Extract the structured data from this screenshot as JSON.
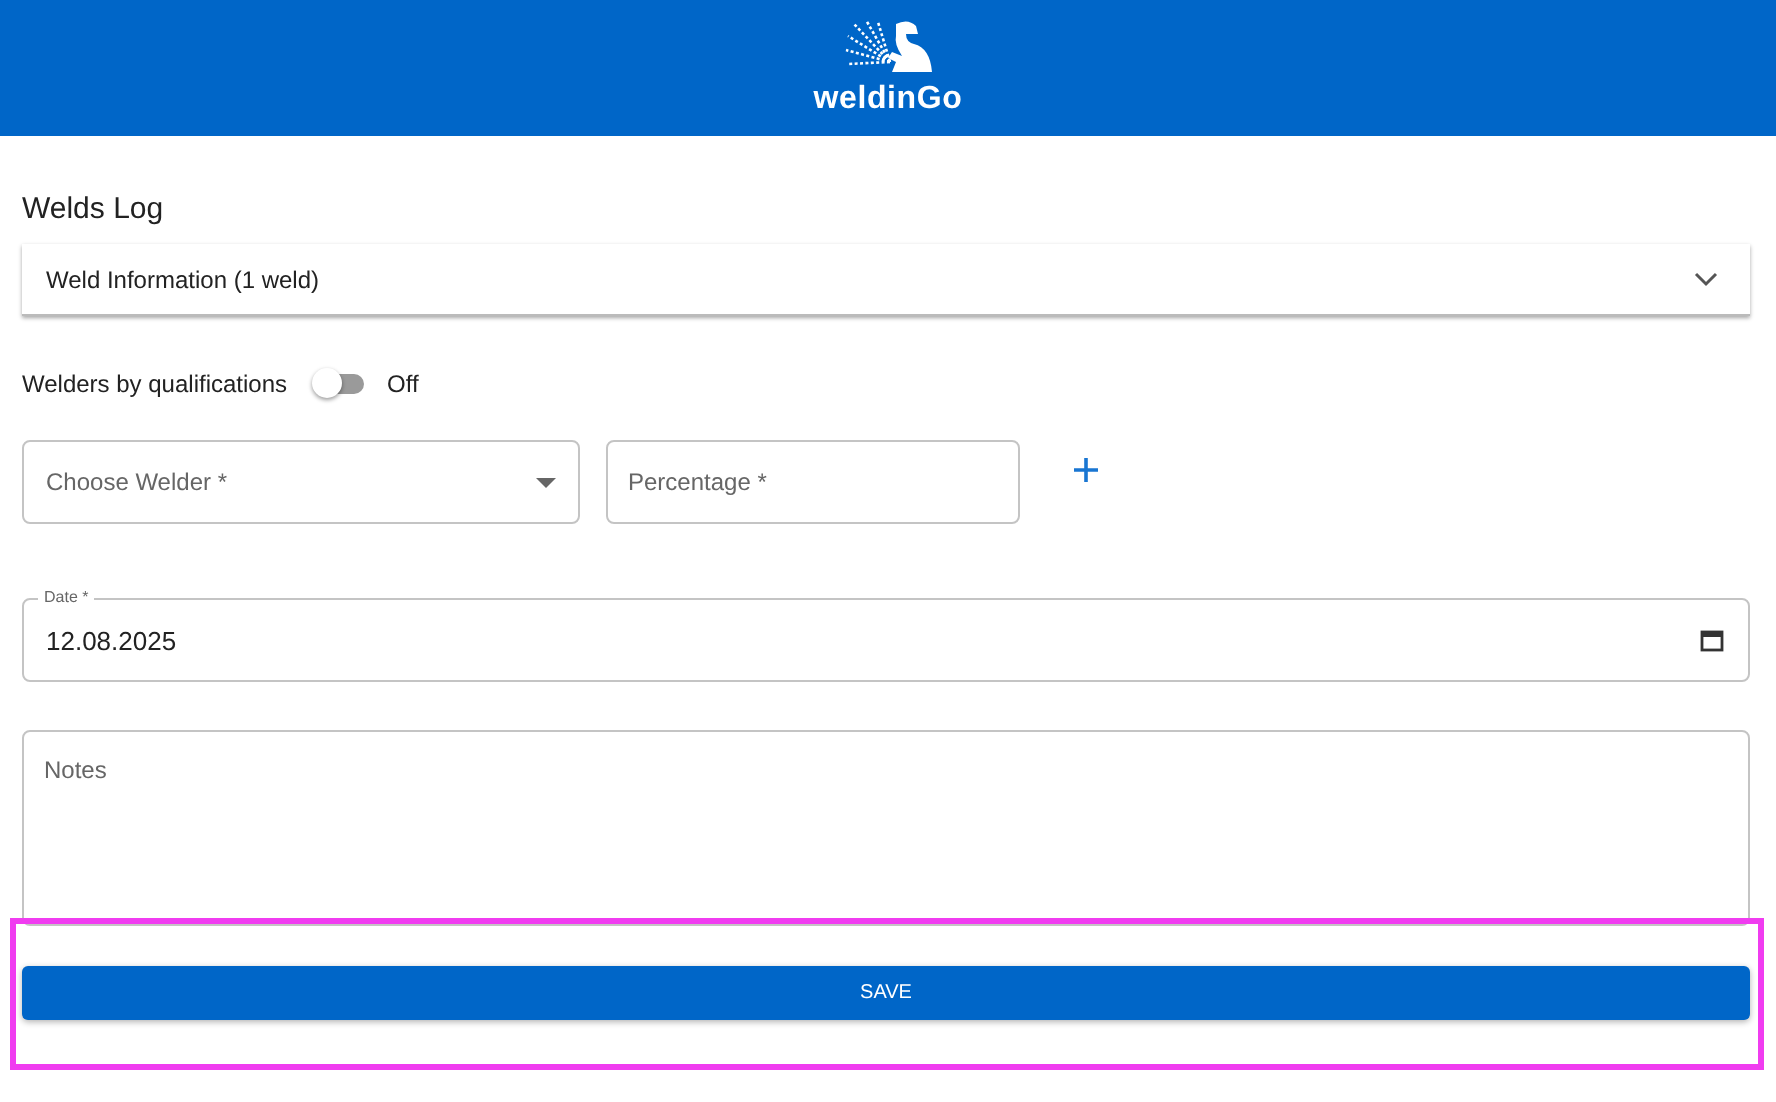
{
  "header": {
    "brand": "weldinGo"
  },
  "page_title": "Welds Log",
  "accordion": {
    "label": "Weld Information (1 weld)",
    "expanded": false
  },
  "qualification_toggle": {
    "label": "Welders by qualifications",
    "on": false,
    "state_label": "Off"
  },
  "welder_select": {
    "placeholder": "Choose Welder *"
  },
  "percentage_field": {
    "placeholder": "Percentage *"
  },
  "date_field": {
    "label": "Date *",
    "value": "12.08.2025"
  },
  "notes_field": {
    "placeholder": "Notes"
  },
  "save_button": {
    "label": "SAVE",
    "highlighted": true
  }
}
